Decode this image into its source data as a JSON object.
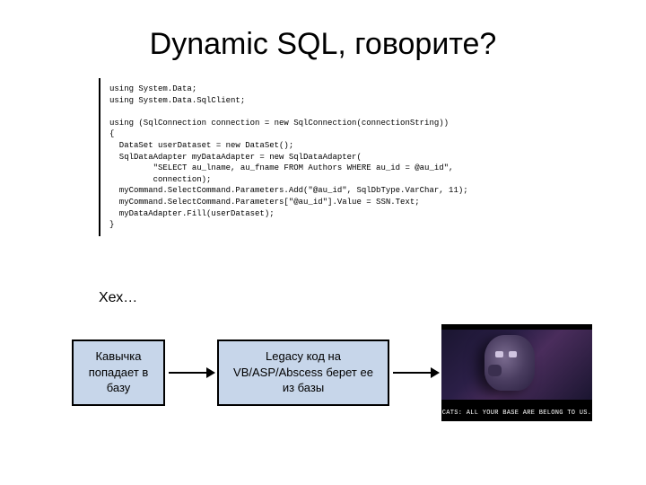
{
  "title": "Dynamic SQL, говорите?",
  "code": "using System.Data;\nusing System.Data.SqlClient;\n\nusing (SqlConnection connection = new SqlConnection(connectionString))\n{\n  DataSet userDataset = new DataSet();\n  SqlDataAdapter myDataAdapter = new SqlDataAdapter(\n         \"SELECT au_lname, au_fname FROM Authors WHERE au_id = @au_id\",\n         connection);\n  myCommand.SelectCommand.Parameters.Add(\"@au_id\", SqlDbType.VarChar, 11);\n  myCommand.SelectCommand.Parameters[\"@au_id\"].Value = SSN.Text;\n  myDataAdapter.Fill(userDataset);\n}",
  "heh": "Хех…",
  "flow": {
    "box1": "Кавычка попадает в базу",
    "box2": "Legacy код на VB/ASP/Abscess берет ее из базы"
  },
  "meme": {
    "caption": "CATS: ALL YOUR BASE ARE BELONG\nTO US."
  }
}
